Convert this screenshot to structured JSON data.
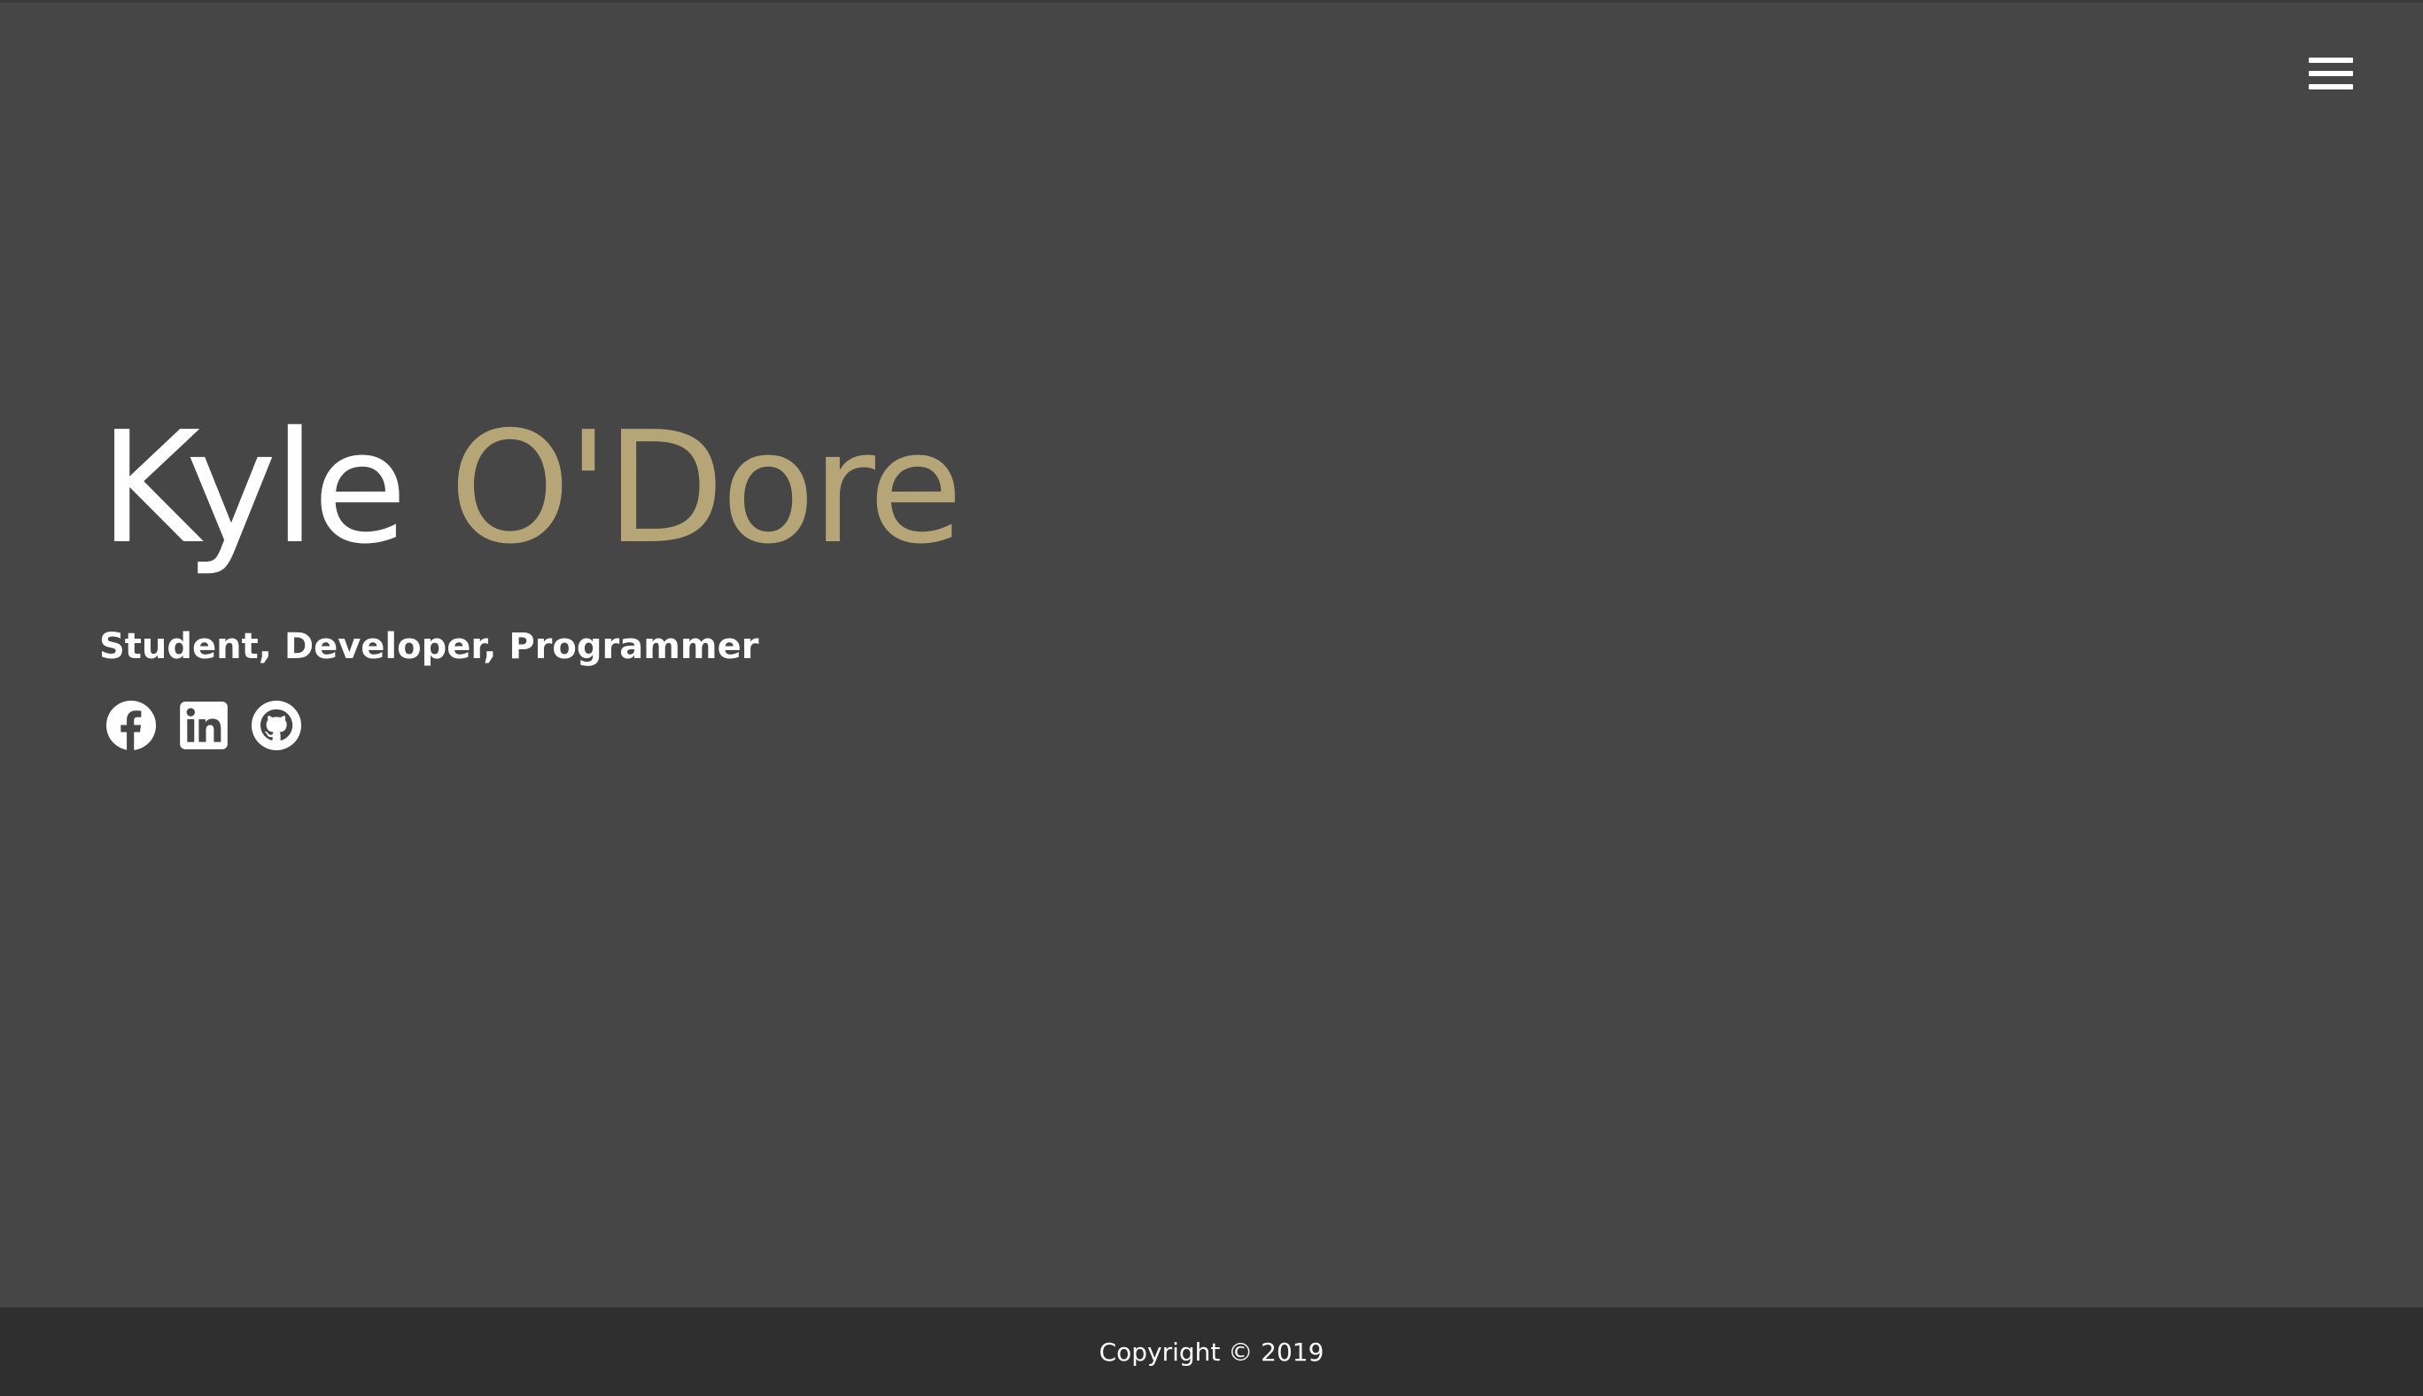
{
  "header": {
    "menu_icon": "hamburger-menu-icon"
  },
  "hero": {
    "first_name": "Kyle",
    "last_name": "O'Dore",
    "tagline": "Student, Developer, Programmer"
  },
  "socials": [
    {
      "icon": "facebook-icon"
    },
    {
      "icon": "linkedin-icon"
    },
    {
      "icon": "github-icon"
    }
  ],
  "footer": {
    "copyright": "Copyright © 2019"
  },
  "colors": {
    "background": "#464646",
    "accent": "#b6a577",
    "footer_background": "#2f2f2f",
    "text": "#ffffff"
  }
}
